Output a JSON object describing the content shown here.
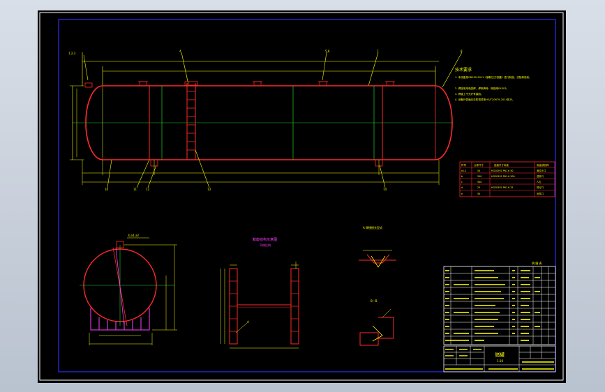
{
  "drawing": {
    "tech_requirements_title": "技术要求",
    "tech_requirements": [
      "1. 本设备按GB150-2011《钢制压力容器》进行制造、试验和验收。",
      "2. 焊接采用电弧焊，焊条牌号：碳钢用E4303。",
      "3. 焊缝上不允许有缺陷。",
      "4. 设备外表面应涂防锈漆按HG/T20679-2014执行。"
    ],
    "nozzle_table_headers": [
      "符号",
      "公称尺寸",
      "连接尺寸标准",
      "用途或名称"
    ],
    "nozzle_table_rows": [
      [
        "a1-2",
        "50",
        "HG20592 PN1.6 50",
        "液位计口"
      ],
      [
        "b",
        "200",
        "HG20592 PN1.6 200",
        "进料口"
      ],
      [
        "c",
        "500",
        "",
        "人孔"
      ],
      [
        "d",
        "25",
        "HG20592 PN1.6 25",
        "排污口"
      ],
      [
        "e",
        "50",
        "",
        "出料口"
      ]
    ],
    "section_title": "鞍座结构示意图",
    "section_subtitle": "不按比例",
    "detail_title": "A 焊接接头型式",
    "detail_label_b": "B—B",
    "title_block_name": "储罐",
    "title_block_scale": "1:10",
    "bom_header": "明 细 表",
    "bom_rows": 10
  },
  "colors": {
    "background": "#000000",
    "vessel": "#ff2a2a",
    "centerline": "#22d022",
    "dimension": "#ffff00",
    "text": "#ffff00",
    "frame": "#ffffff",
    "border": "#3030ff",
    "support": "#ff3fff"
  }
}
